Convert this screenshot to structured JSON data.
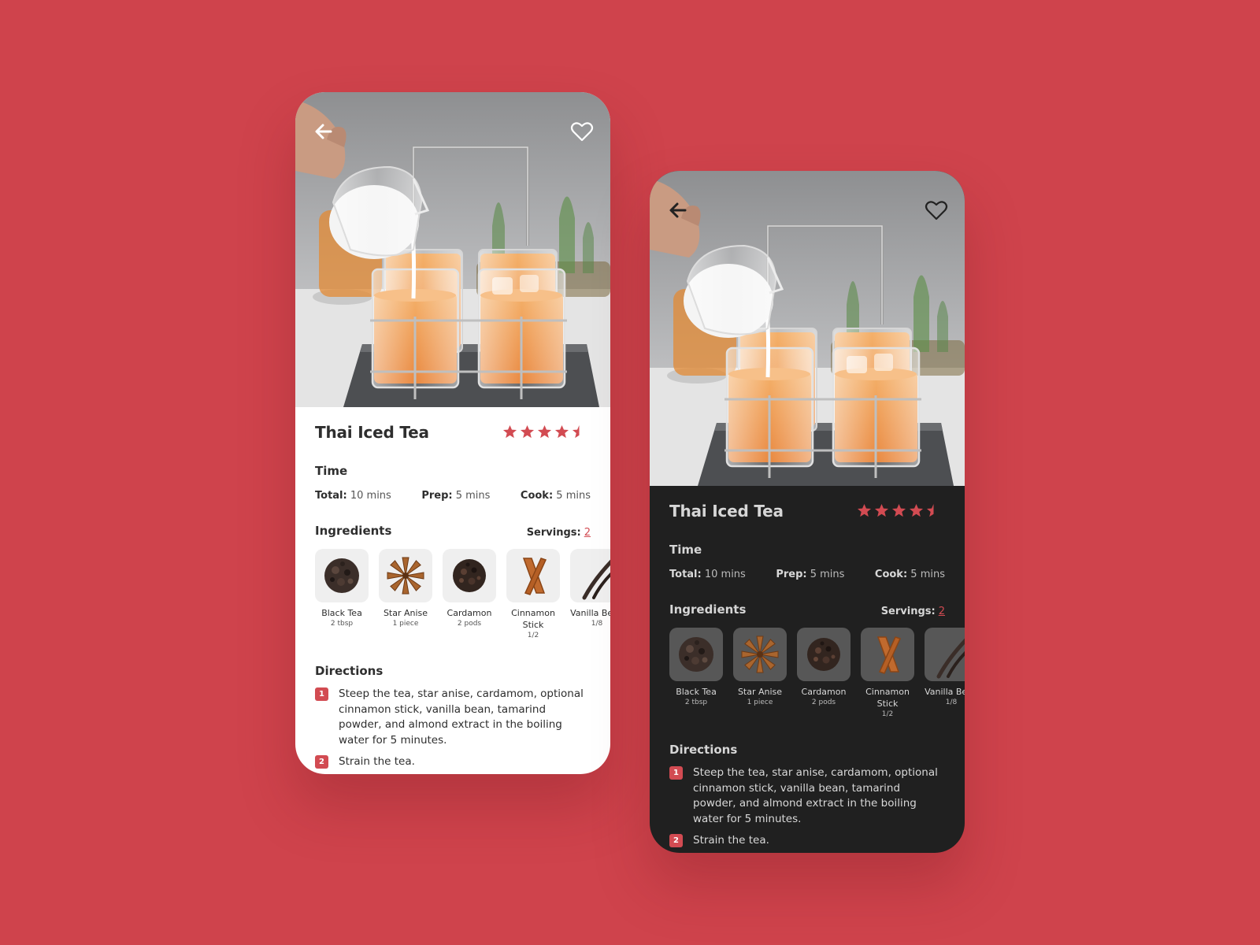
{
  "colors": {
    "background": "#cf434c",
    "accent": "#d24b52",
    "dark_surface": "#202020"
  },
  "recipe": {
    "title": "Thai Iced Tea",
    "rating": 4.5,
    "rating_max": 5,
    "time_heading": "Time",
    "time": [
      {
        "label": "Total:",
        "value": "10 mins"
      },
      {
        "label": "Prep:",
        "value": "5 mins"
      },
      {
        "label": "Cook:",
        "value": "5 mins"
      }
    ],
    "ingredients_heading": "Ingredients",
    "servings_label": "Servings:",
    "servings_value": "2",
    "ingredients": [
      {
        "name": "Black Tea",
        "qty": "2 tbsp",
        "icon": "black-tea-icon"
      },
      {
        "name": "Star Anise",
        "qty": "1 piece",
        "icon": "star-anise-icon"
      },
      {
        "name": "Cardamon",
        "qty": "2 pods",
        "icon": "cardamom-icon"
      },
      {
        "name": "Cinnamon Stick",
        "qty": "1/2",
        "icon": "cinnamon-stick-icon"
      },
      {
        "name": "Vanilla Bean",
        "qty": "1/8",
        "icon": "vanilla-bean-icon"
      }
    ],
    "directions_heading": "Directions",
    "directions": [
      {
        "num": "1",
        "text": "Steep the tea, star anise, cardamom, optional cinnamon stick, vanilla bean, tamarind powder, and almond extract in the boiling water for 5 minutes."
      },
      {
        "num": "2",
        "text": "Strain the tea."
      }
    ]
  },
  "icons": {
    "back": "back-arrow-icon",
    "favorite": "heart-icon",
    "star": "star-icon"
  }
}
